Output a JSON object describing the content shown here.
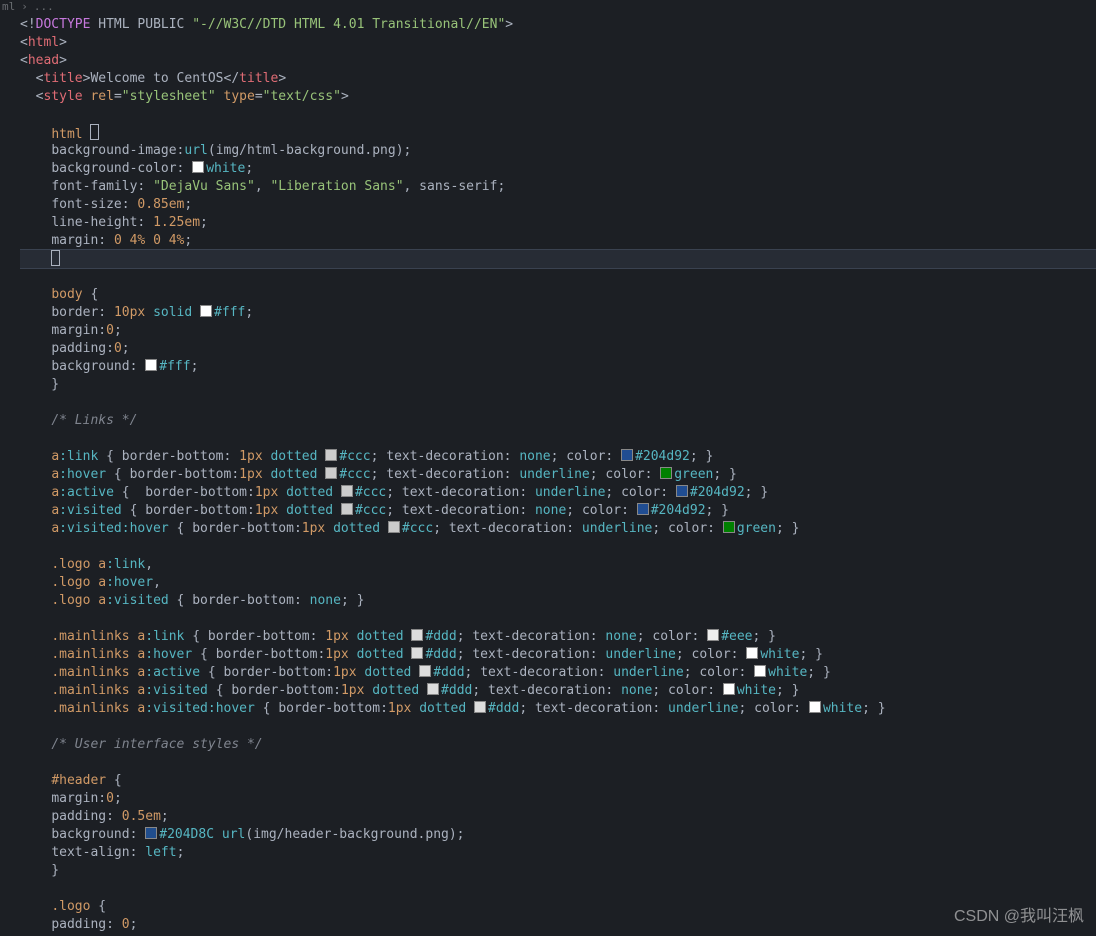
{
  "breadcrumb": {
    "item1": "ml",
    "item2": "..."
  },
  "watermark": "CSDN @我叫汪枫",
  "colors": {
    "white": "#ffffff",
    "fff": "#ffffff",
    "ccc": "#cccccc",
    "ddd": "#dddddd",
    "eee": "#eeeeee",
    "link": "#204d92",
    "green": "#008000",
    "headerbg": "#204D8C"
  },
  "code": {
    "l1": {
      "a": "<!",
      "b": "DOCTYPE",
      "c": " HTML PUBLIC ",
      "d": "\"-//W3C//DTD HTML 4.01 Transitional//EN\"",
      "e": ">"
    },
    "l2": {
      "a": "<",
      "b": "html",
      "c": ">"
    },
    "l3": {
      "a": "<",
      "b": "head",
      "c": ">"
    },
    "l4": {
      "a": "  <",
      "b": "title",
      "c": ">",
      "d": "Welcome to CentOS",
      "e": "</",
      "f": "title",
      "g": ">"
    },
    "l5": {
      "a": "  <",
      "b": "style",
      "c": " ",
      "d": "rel",
      "e": "=",
      "f": "\"stylesheet\"",
      "g": " ",
      "h": "type",
      "i": "=",
      "j": "\"text/css\"",
      "k": ">"
    },
    "l6": "",
    "l7": {
      "a": "    ",
      "b": "html",
      "c": " "
    },
    "l8": {
      "a": "    ",
      "b": "background-image",
      "c": ":",
      "d": "url",
      "e": "(",
      "f": "img/html-background.png",
      "g": ");"
    },
    "l9": {
      "a": "    ",
      "b": "background-color",
      "c": ": ",
      "sw": "white",
      "d": "white",
      "e": ";"
    },
    "l10": {
      "a": "    ",
      "b": "font-family",
      "c": ": ",
      "d": "\"DejaVu Sans\"",
      "e": ", ",
      "f": "\"Liberation Sans\"",
      "g": ", sans-serif;"
    },
    "l11": {
      "a": "    ",
      "b": "font-size",
      "c": ": ",
      "d": "0.85em",
      "e": ";"
    },
    "l12": {
      "a": "    ",
      "b": "line-height",
      "c": ": ",
      "d": "1.25em",
      "e": ";"
    },
    "l13": {
      "a": "    ",
      "b": "margin",
      "c": ": ",
      "d": "0",
      "e": " ",
      "f": "4%",
      "g": " ",
      "h": "0",
      "i": " ",
      "j": "4%",
      "k": ";"
    },
    "l14": {
      "a": "    "
    },
    "l15": "",
    "l16": {
      "a": "    ",
      "b": "body",
      "c": " {"
    },
    "l17": {
      "a": "    ",
      "b": "border",
      "c": ": ",
      "d": "10px",
      "e": " ",
      "f": "solid",
      "g": " ",
      "sw": "fff",
      "h": "#fff",
      "i": ";"
    },
    "l18": {
      "a": "    ",
      "b": "margin",
      "c": ":",
      "d": "0",
      "e": ";"
    },
    "l19": {
      "a": "    ",
      "b": "padding",
      "c": ":",
      "d": "0",
      "e": ";"
    },
    "l20": {
      "a": "    ",
      "b": "background",
      "c": ": ",
      "sw": "fff",
      "d": "#fff",
      "e": ";"
    },
    "l21": {
      "a": "    }"
    },
    "l22": "",
    "l23": {
      "a": "    ",
      "b": "/* Links */"
    },
    "l24": "",
    "l25": {
      "a": "    ",
      "b": "a",
      "c": ":link",
      "d": " { ",
      "e": "border-bottom",
      "f": ": ",
      "g": "1px",
      "h": " ",
      "i": "dotted",
      "j": " ",
      "sw": "ccc",
      "k": "#ccc",
      "l": "; ",
      "m": "text-decoration",
      "n": ": ",
      "o": "none",
      "p": "; ",
      "q": "color",
      "r": ": ",
      "sw2": "link",
      "s": "#204d92",
      "t": "; }"
    },
    "l26": {
      "a": "    ",
      "b": "a",
      "c": ":hover",
      "d": " { ",
      "e": "border-bottom",
      "f": ":",
      "g": "1px",
      "h": " ",
      "i": "dotted",
      "j": " ",
      "sw": "ccc",
      "k": "#ccc",
      "l": "; ",
      "m": "text-decoration",
      "n": ": ",
      "o": "underline",
      "p": "; ",
      "q": "color",
      "r": ": ",
      "sw2": "green",
      "s": "green",
      "t": "; }"
    },
    "l27": {
      "a": "    ",
      "b": "a",
      "c": ":active",
      "d": " {  ",
      "e": "border-bottom",
      "f": ":",
      "g": "1px",
      "h": " ",
      "i": "dotted",
      "j": " ",
      "sw": "ccc",
      "k": "#ccc",
      "l": "; ",
      "m": "text-decoration",
      "n": ": ",
      "o": "underline",
      "p": "; ",
      "q": "color",
      "r": ": ",
      "sw2": "link",
      "s": "#204d92",
      "t": "; }"
    },
    "l28": {
      "a": "    ",
      "b": "a",
      "c": ":visited",
      "d": " { ",
      "e": "border-bottom",
      "f": ":",
      "g": "1px",
      "h": " ",
      "i": "dotted",
      "j": " ",
      "sw": "ccc",
      "k": "#ccc",
      "l": "; ",
      "m": "text-decoration",
      "n": ": ",
      "o": "none",
      "p": "; ",
      "q": "color",
      "r": ": ",
      "sw2": "link",
      "s": "#204d92",
      "t": "; }"
    },
    "l29": {
      "a": "    ",
      "b": "a",
      "c": ":visited:hover",
      "d": " { ",
      "e": "border-bottom",
      "f": ":",
      "g": "1px",
      "h": " ",
      "i": "dotted",
      "j": " ",
      "sw": "ccc",
      "k": "#ccc",
      "l": "; ",
      "m": "text-decoration",
      "n": ": ",
      "o": "underline",
      "p": "; ",
      "q": "color",
      "r": ": ",
      "sw2": "green",
      "s": "green",
      "t": "; }"
    },
    "l30": "",
    "l31": {
      "a": "    ",
      "b": ".logo",
      "c": " ",
      "d": "a",
      "e": ":link",
      "f": ","
    },
    "l32": {
      "a": "    ",
      "b": ".logo",
      "c": " ",
      "d": "a",
      "e": ":hover",
      "f": ","
    },
    "l33": {
      "a": "    ",
      "b": ".logo",
      "c": " ",
      "d": "a",
      "e": ":visited",
      "f": " { ",
      "g": "border-bottom",
      "h": ": ",
      "i": "none",
      "j": "; }"
    },
    "l34": "",
    "l35": {
      "a": "    ",
      "b": ".mainlinks",
      "c": " ",
      "d": "a",
      "e": ":link",
      "f": " { ",
      "g": "border-bottom",
      "h": ": ",
      "i": "1px",
      "j": " ",
      "k": "dotted",
      "l": " ",
      "sw": "ddd",
      "m": "#ddd",
      "n": "; ",
      "o": "text-decoration",
      "p": ": ",
      "q": "none",
      "r": "; ",
      "s": "color",
      "t": ": ",
      "sw2": "eee",
      "u": "#eee",
      "v": "; }"
    },
    "l36": {
      "a": "    ",
      "b": ".mainlinks",
      "c": " ",
      "d": "a",
      "e": ":hover",
      "f": " { ",
      "g": "border-bottom",
      "h": ":",
      "i": "1px",
      "j": " ",
      "k": "dotted",
      "l": " ",
      "sw": "ddd",
      "m": "#ddd",
      "n": "; ",
      "o": "text-decoration",
      "p": ": ",
      "q": "underline",
      "r": "; ",
      "s": "color",
      "t": ": ",
      "sw2": "white",
      "u": "white",
      "v": "; }"
    },
    "l37": {
      "a": "    ",
      "b": ".mainlinks",
      "c": " ",
      "d": "a",
      "e": ":active",
      "f": " { ",
      "g": "border-bottom",
      "h": ":",
      "i": "1px",
      "j": " ",
      "k": "dotted",
      "l": " ",
      "sw": "ddd",
      "m": "#ddd",
      "n": "; ",
      "o": "text-decoration",
      "p": ": ",
      "q": "underline",
      "r": "; ",
      "s": "color",
      "t": ": ",
      "sw2": "white",
      "u": "white",
      "v": "; }"
    },
    "l38": {
      "a": "    ",
      "b": ".mainlinks",
      "c": " ",
      "d": "a",
      "e": ":visited",
      "f": " { ",
      "g": "border-bottom",
      "h": ":",
      "i": "1px",
      "j": " ",
      "k": "dotted",
      "l": " ",
      "sw": "ddd",
      "m": "#ddd",
      "n": "; ",
      "o": "text-decoration",
      "p": ": ",
      "q": "none",
      "r": "; ",
      "s": "color",
      "t": ": ",
      "sw2": "white",
      "u": "white",
      "v": "; }"
    },
    "l39": {
      "a": "    ",
      "b": ".mainlinks",
      "c": " ",
      "d": "a",
      "e": ":visited:hover",
      "f": " { ",
      "g": "border-bottom",
      "h": ":",
      "i": "1px",
      "j": " ",
      "k": "dotted",
      "l": " ",
      "sw": "ddd",
      "m": "#ddd",
      "n": "; ",
      "o": "text-decoration",
      "p": ": ",
      "q": "underline",
      "r": "; ",
      "s": "color",
      "t": ": ",
      "sw2": "white",
      "u": "white",
      "v": "; }"
    },
    "l40": "",
    "l41": {
      "a": "    ",
      "b": "/* User interface styles */"
    },
    "l42": "",
    "l43": {
      "a": "    ",
      "b": "#header",
      "c": " {"
    },
    "l44": {
      "a": "    ",
      "b": "margin",
      "c": ":",
      "d": "0",
      "e": ";"
    },
    "l45": {
      "a": "    ",
      "b": "padding",
      "c": ": ",
      "d": "0.5em",
      "e": ";"
    },
    "l46": {
      "a": "    ",
      "b": "background",
      "c": ": ",
      "sw": "headerbg",
      "d": "#204D8C",
      "e": " ",
      "f": "url",
      "g": "(",
      "h": "img/header-background.png",
      "i": ");"
    },
    "l47": {
      "a": "    ",
      "b": "text-align",
      "c": ": ",
      "d": "left",
      "e": ";"
    },
    "l48": {
      "a": "    }"
    },
    "l49": "",
    "l50": {
      "a": "    ",
      "b": ".logo",
      "c": " {"
    },
    "l51": {
      "a": "    ",
      "b": "padding",
      "c": ": ",
      "d": "0",
      "e": ";"
    }
  }
}
